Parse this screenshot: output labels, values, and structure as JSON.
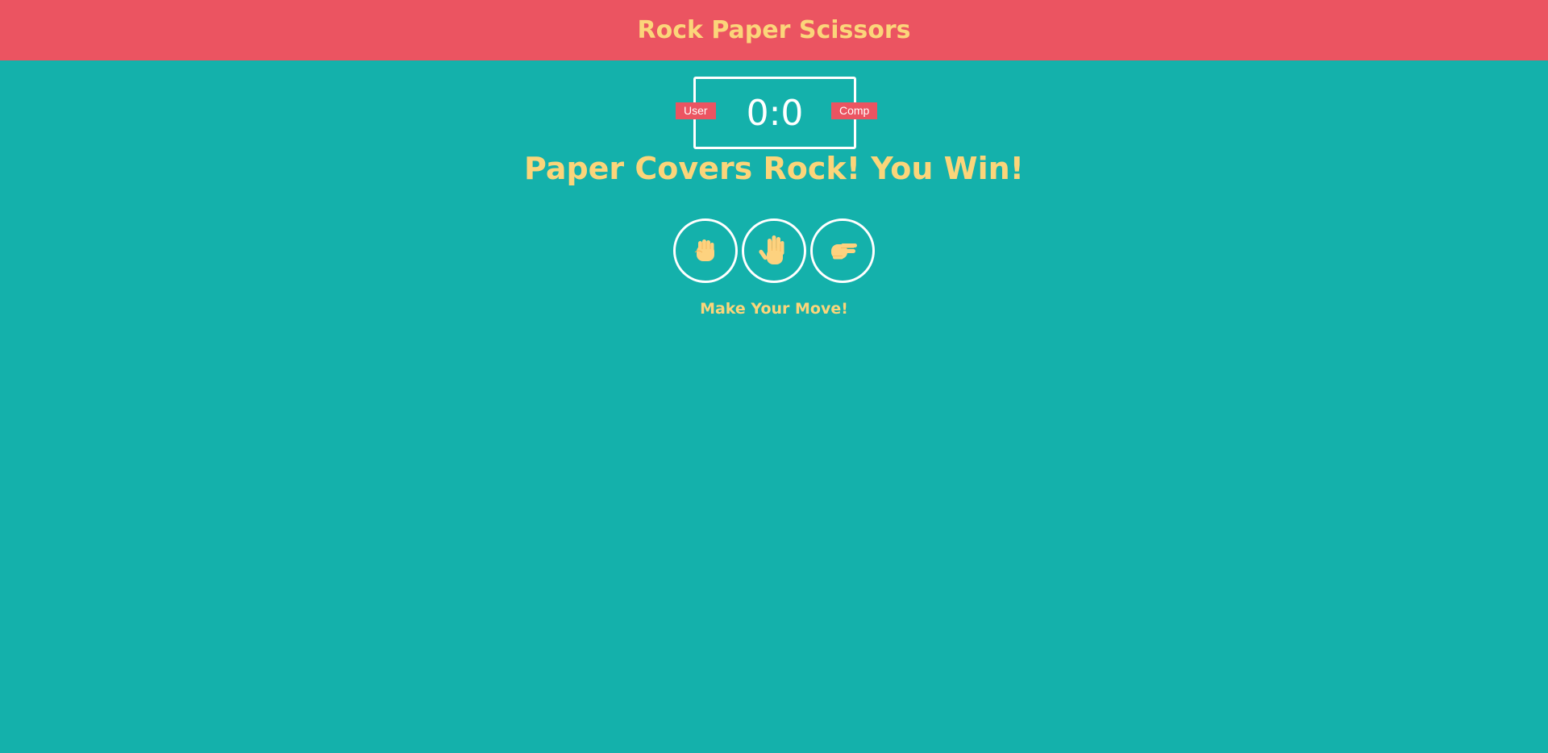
{
  "header": {
    "title": "Rock Paper Scissors"
  },
  "score": {
    "user_label": "User",
    "comp_label": "Comp",
    "value": "0:0"
  },
  "result": {
    "message": "Paper Covers Rock! You Win!"
  },
  "choices": [
    {
      "name": "rock",
      "icon": "fist-icon"
    },
    {
      "name": "paper",
      "icon": "hand-icon"
    },
    {
      "name": "scissors",
      "icon": "victory-hand-icon"
    }
  ],
  "prompt": {
    "text": "Make Your Move!"
  },
  "colors": {
    "background": "#14b1ab",
    "header": "#eb5461",
    "accent_text": "#fbd57a",
    "skin": "#fdd27f",
    "white": "#ffffff"
  }
}
